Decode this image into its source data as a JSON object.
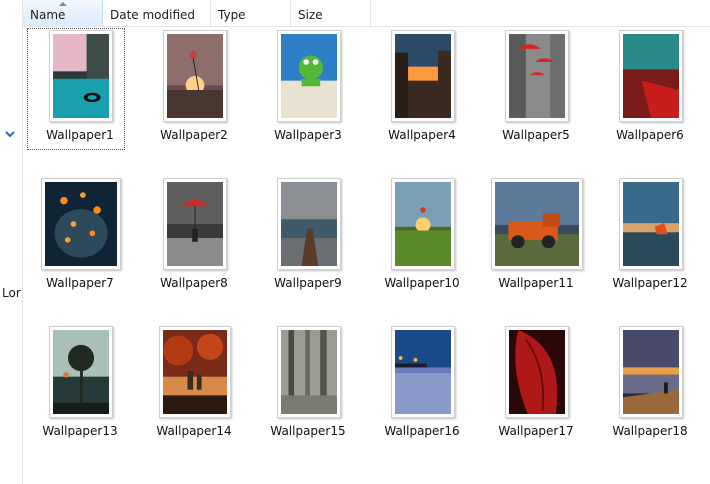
{
  "columns": {
    "name": "Name",
    "date": "Date modified",
    "type": "Type",
    "size": "Size"
  },
  "nav": {
    "truncated_label": "Lor"
  },
  "files": [
    {
      "name": "Wallpaper1",
      "selected": true,
      "thumb": "pool-icon"
    },
    {
      "name": "Wallpaper2",
      "thumb": "sunset-balloon-icon"
    },
    {
      "name": "Wallpaper3",
      "thumb": "frog-beach-icon"
    },
    {
      "name": "Wallpaper4",
      "thumb": "dusk-street-icon"
    },
    {
      "name": "Wallpaper5",
      "thumb": "red-umbrella-street-icon"
    },
    {
      "name": "Wallpaper6",
      "thumb": "red-field-icon"
    },
    {
      "name": "Wallpaper7",
      "thumb": "bokeh-jar-icon"
    },
    {
      "name": "Wallpaper8",
      "thumb": "umbrella-storm-icon"
    },
    {
      "name": "Wallpaper9",
      "thumb": "pier-icon"
    },
    {
      "name": "Wallpaper10",
      "thumb": "meadow-sunset-icon"
    },
    {
      "name": "Wallpaper11",
      "thumb": "old-truck-icon"
    },
    {
      "name": "Wallpaper12",
      "thumb": "lake-dusk-icon"
    },
    {
      "name": "Wallpaper13",
      "thumb": "tree-silhouette-icon"
    },
    {
      "name": "Wallpaper14",
      "thumb": "autumn-city-icon"
    },
    {
      "name": "Wallpaper15",
      "thumb": "foggy-forest-icon"
    },
    {
      "name": "Wallpaper16",
      "thumb": "blue-pier-night-icon"
    },
    {
      "name": "Wallpaper17",
      "thumb": "red-leaf-icon"
    },
    {
      "name": "Wallpaper18",
      "thumb": "dock-sunset-icon"
    }
  ]
}
